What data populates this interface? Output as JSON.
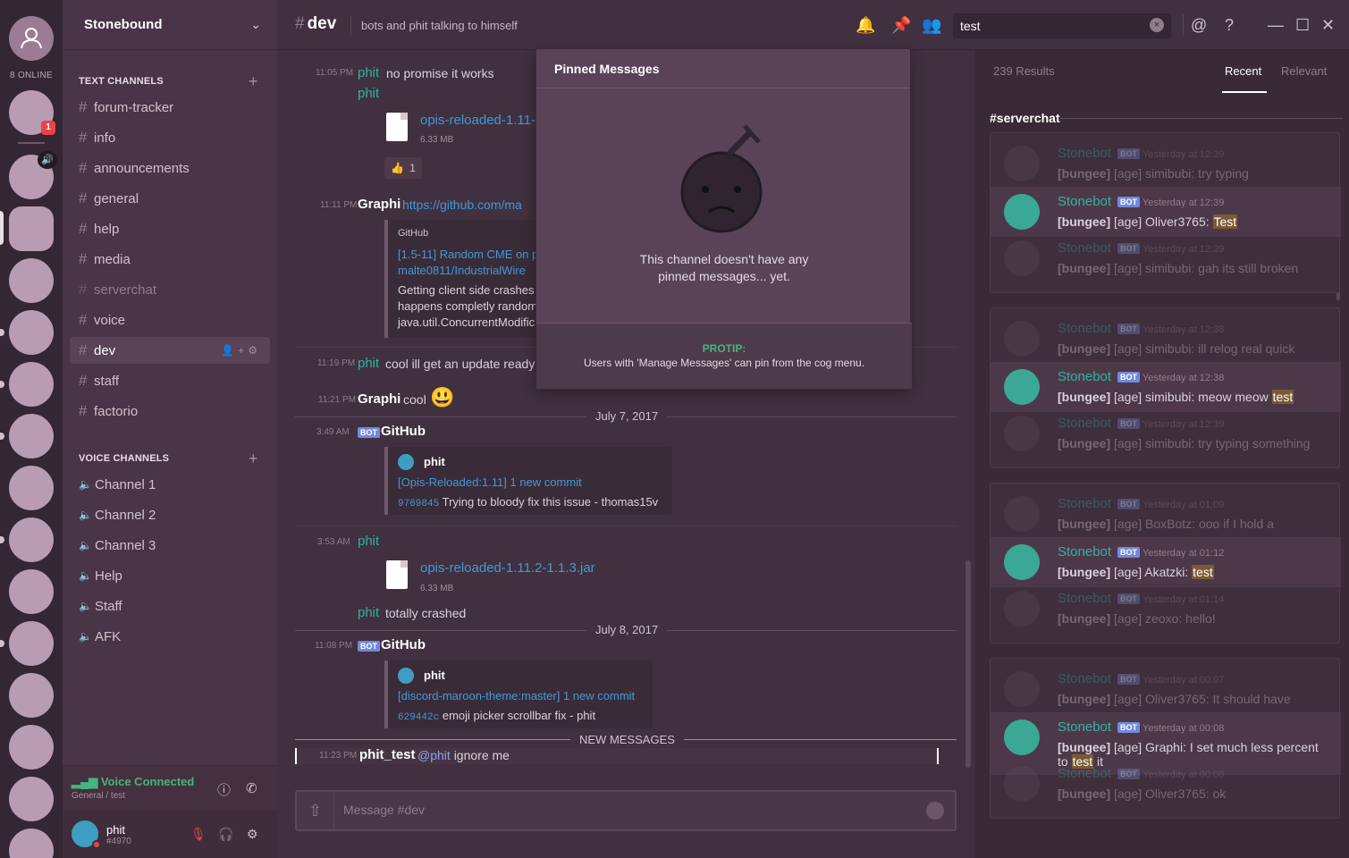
{
  "guilds": {
    "online_label": "8 ONLINE",
    "badge": "1"
  },
  "server": {
    "name": "Stonebound"
  },
  "text_channels_label": "TEXT CHANNELS",
  "text_channels": [
    "forum-tracker",
    "info",
    "announcements",
    "general",
    "help",
    "media",
    "serverchat",
    "voice",
    "dev",
    "staff",
    "factorio"
  ],
  "voice_channels_label": "VOICE CHANNELS",
  "voice_channels": [
    "Channel 1",
    "Channel 2",
    "Channel 3",
    "Help",
    "Staff",
    "AFK"
  ],
  "voice_panel": {
    "status": "Voice Connected",
    "location": "General / test"
  },
  "user": {
    "name": "phit",
    "tag": "#4970"
  },
  "header": {
    "hash": "#",
    "channel": "dev",
    "topic": "bots and phit talking to himself",
    "search_value": "test"
  },
  "messages": {
    "m1_time": "11:05 PM",
    "m1_author": "phit",
    "m1_text": "no promise it works",
    "m1b_author": "phit",
    "m1_file": "opis-reloaded-1.11-1",
    "m1_size": "6.33 MB",
    "m1_reaction": "1",
    "m2_time": "11:11 PM",
    "m2_author": "Graphi",
    "m2_link": "https://github.com/ma",
    "m2_embed_provider": "GitHub",
    "m2_embed_title1": "[1.5-11] Random CME on p",
    "m2_embed_title2": "malte0811/IndustrialWire",
    "m2_embed_desc1": "Getting client side crashes",
    "m2_embed_desc2": "happens completly random",
    "m2_embed_desc3": "java.util.ConcurrentModific",
    "m3_time": "11:19 PM",
    "m3_author": "phit",
    "m3_text": "cool ill get an update ready",
    "m4_time": "11:21 PM",
    "m4_author": "Graphi",
    "m4_text": "cool",
    "div1": "July 7, 2017",
    "m5_time": "3:49 AM",
    "m5_bot": "BOT",
    "m5_author": "GitHub",
    "m5_embed_user": "phit",
    "m5_embed_title": "[Opis-Reloaded:1.11] 1 new commit",
    "m5_hash": "9769845",
    "m5_commit": "Trying to bloody fix this issue - thomas15v",
    "m6_time": "3:53 AM",
    "m6_author": "phit",
    "m6_file": "opis-reloaded-1.11.2-1.1.3.jar",
    "m6_size": "6.33 MB",
    "m7_author": "phit",
    "m7_text": "totally crashed",
    "div2": "July 8, 2017",
    "m8_time": "11:08 PM",
    "m8_bot": "BOT",
    "m8_author": "GitHub",
    "m8_embed_user": "phit",
    "m8_embed_title": "[discord-maroon-theme:master] 1 new commit",
    "m8_hash": "629442c",
    "m8_commit": "emoji picker scrollbar fix - phit",
    "new_label": "NEW MESSAGES",
    "m9_time": "11:23 PM",
    "m9_author": "phit_test",
    "m9_mention": "@phit",
    "m9_text": "ignore me"
  },
  "composer": {
    "placeholder": "Message #dev"
  },
  "pinned": {
    "title": "Pinned Messages",
    "empty_line1": "This channel doesn't have any",
    "empty_line2": "pinned messages... yet.",
    "protip_label": "PROTIP:",
    "protip_text": "Users with 'Manage Messages' can pin from the cog menu."
  },
  "search_results": {
    "count": "239 Results",
    "tab_recent": "Recent",
    "tab_relevant": "Relevant",
    "channel": "#serverchat",
    "groups": [
      {
        "items": [
          {
            "name": "Stonebot",
            "bot": "BOT",
            "time": "Yesterday at 12:39",
            "prefix": "[bungee]",
            "text": "[age] simibubi: try typing",
            "hl": "",
            "after": ""
          },
          {
            "name": "Stonebot",
            "bot": "BOT",
            "time": "Yesterday at 12:39",
            "prefix": "[bungee]",
            "text": "[age] Oliver3765: ",
            "hl": "Test",
            "after": ""
          },
          {
            "name": "Stonebot",
            "bot": "BOT",
            "time": "Yesterday at 12:39",
            "prefix": "[bungee]",
            "text": "[age] simibubi: gah its still broken",
            "hl": "",
            "after": ""
          }
        ]
      },
      {
        "items": [
          {
            "name": "Stonebot",
            "bot": "BOT",
            "time": "Yesterday at 12:38",
            "prefix": "[bungee]",
            "text": "[age] simibubi: ill relog real quick",
            "hl": "",
            "after": ""
          },
          {
            "name": "Stonebot",
            "bot": "BOT",
            "time": "Yesterday at 12:38",
            "prefix": "[bungee]",
            "text": "[age] simibubi: meow meow ",
            "hl": "test",
            "after": ""
          },
          {
            "name": "Stonebot",
            "bot": "BOT",
            "time": "Yesterday at 12:39",
            "prefix": "[bungee]",
            "text": "[age] simibubi: try typing something",
            "hl": "",
            "after": ""
          }
        ]
      },
      {
        "items": [
          {
            "name": "Stonebot",
            "bot": "BOT",
            "time": "Yesterday at 01:09",
            "prefix": "[bungee]",
            "text": "[age] BoxBotz: ooo if I hold a",
            "hl": "",
            "after": ""
          },
          {
            "name": "Stonebot",
            "bot": "BOT",
            "time": "Yesterday at 01:12",
            "prefix": "[bungee]",
            "text": "[age] Akatzki: ",
            "hl": "test",
            "after": ""
          },
          {
            "name": "Stonebot",
            "bot": "BOT",
            "time": "Yesterday at 01:14",
            "prefix": "[bungee]",
            "text": "[age] zeoxo: hello!",
            "hl": "",
            "after": ""
          }
        ]
      },
      {
        "items": [
          {
            "name": "Stonebot",
            "bot": "BOT",
            "time": "Yesterday at 00:07",
            "prefix": "[bungee]",
            "text": "[age] Oliver3765: It should have",
            "hl": "",
            "after": ""
          },
          {
            "name": "Stonebot",
            "bot": "BOT",
            "time": "Yesterday at 00:08",
            "prefix": "[bungee]",
            "text": "[age] Graphi: I set much less percent to ",
            "hl": "test",
            "after": " it"
          },
          {
            "name": "Stonebot",
            "bot": "BOT",
            "time": "Yesterday at 00:08",
            "prefix": "[bungee]",
            "text": "[age] Oliver3765: ok",
            "hl": "",
            "after": ""
          }
        ]
      }
    ]
  }
}
